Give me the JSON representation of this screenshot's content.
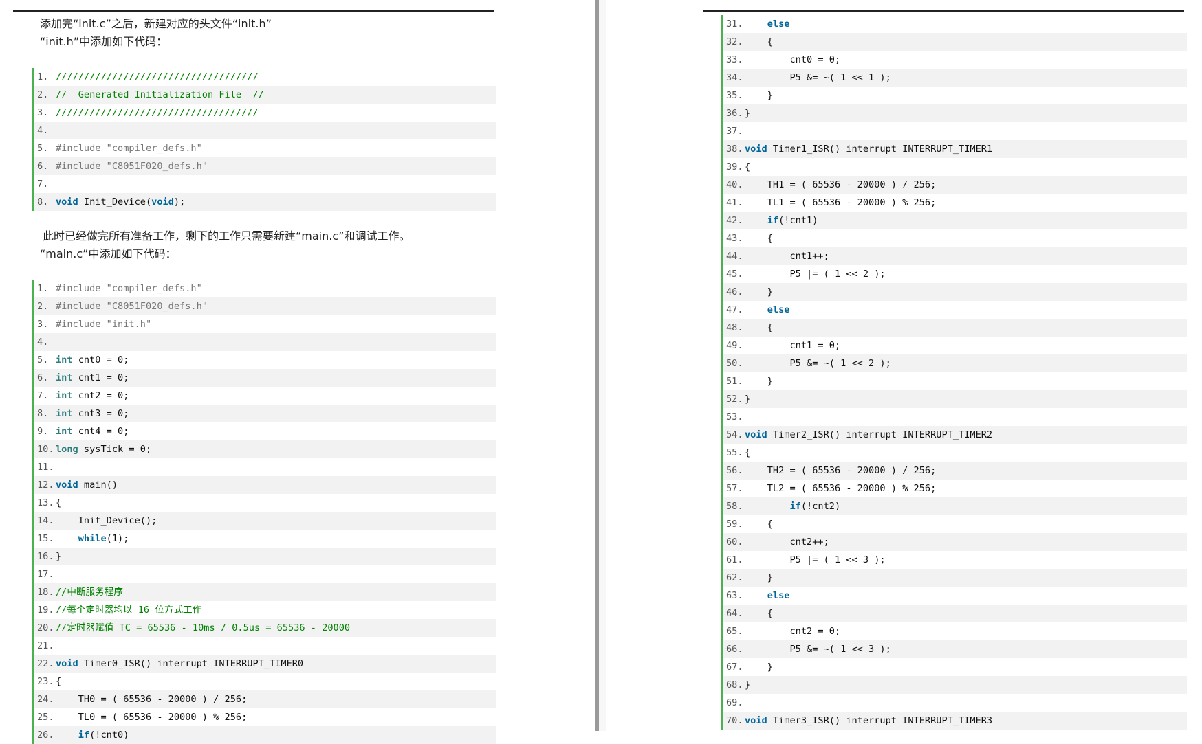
{
  "left_page": {
    "intro_line1": "添加完“init.c”之后，新建对应的头文件“init.h”",
    "intro_line2": "“init.h”中添加如下代码：",
    "init_h_code": [
      {
        "n": "1.",
        "t": "////////////////////////////////////",
        "c": "comment"
      },
      {
        "n": "2.",
        "t": "//  Generated Initialization File  //",
        "c": "comment"
      },
      {
        "n": "3.",
        "t": "////////////////////////////////////",
        "c": "comment"
      },
      {
        "n": "4.",
        "t": "",
        "c": "plain"
      },
      {
        "n": "5.",
        "t": "#include \"compiler_defs.h\"",
        "c": "pp"
      },
      {
        "n": "6.",
        "t": "#include \"C8051F020_defs.h\"",
        "c": "pp"
      },
      {
        "n": "7.",
        "t": "",
        "c": "plain"
      },
      {
        "n": "8.",
        "t": "void Init_Device(void);",
        "c": "plain"
      }
    ],
    "middle_line1": "此时已经做完所有准备工作，剩下的工作只需要新建“main.c”和调试工作。",
    "middle_line2": "“main.c”中添加如下代码：",
    "main_c_code": [
      {
        "n": "1.",
        "t": "#include \"compiler_defs.h\"",
        "c": "pp"
      },
      {
        "n": "2.",
        "t": "#include \"C8051F020_defs.h\"",
        "c": "pp"
      },
      {
        "n": "3.",
        "t": "#include \"init.h\"",
        "c": "pp"
      },
      {
        "n": "4.",
        "t": "",
        "c": "plain"
      },
      {
        "n": "5.",
        "t": "int cnt0 = 0;",
        "c": "plain"
      },
      {
        "n": "6.",
        "t": "int cnt1 = 0;",
        "c": "plain"
      },
      {
        "n": "7.",
        "t": "int cnt2 = 0;",
        "c": "plain"
      },
      {
        "n": "8.",
        "t": "int cnt3 = 0;",
        "c": "plain"
      },
      {
        "n": "9.",
        "t": "int cnt4 = 0;",
        "c": "plain"
      },
      {
        "n": "10.",
        "t": "long sysTick = 0;",
        "c": "plain"
      },
      {
        "n": "11.",
        "t": "",
        "c": "plain"
      },
      {
        "n": "12.",
        "t": "void main()",
        "c": "plain"
      },
      {
        "n": "13.",
        "t": "{",
        "c": "plain"
      },
      {
        "n": "14.",
        "t": "    Init_Device();",
        "c": "plain"
      },
      {
        "n": "15.",
        "t": "    while(1);",
        "c": "plain"
      },
      {
        "n": "16.",
        "t": "}",
        "c": "plain"
      },
      {
        "n": "17.",
        "t": "",
        "c": "plain"
      },
      {
        "n": "18.",
        "t": "//中断服务程序",
        "c": "comment"
      },
      {
        "n": "19.",
        "t": "//每个定时器均以 16 位方式工作",
        "c": "comment"
      },
      {
        "n": "20.",
        "t": "//定时器赋值 TC = 65536 - 10ms / 0.5us = 65536 - 20000",
        "c": "comment"
      },
      {
        "n": "21.",
        "t": "",
        "c": "plain"
      },
      {
        "n": "22.",
        "t": "void Timer0_ISR() interrupt INTERRUPT_TIMER0",
        "c": "plain"
      },
      {
        "n": "23.",
        "t": "{",
        "c": "plain"
      },
      {
        "n": "24.",
        "t": "    TH0 = ( 65536 - 20000 ) / 256;",
        "c": "plain"
      },
      {
        "n": "25.",
        "t": "    TL0 = ( 65536 - 20000 ) % 256;",
        "c": "plain"
      },
      {
        "n": "26.",
        "t": "    if(!cnt0)",
        "c": "plain"
      }
    ]
  },
  "right_page": {
    "code": [
      {
        "n": "31.",
        "t": "    else",
        "c": "plain"
      },
      {
        "n": "32.",
        "t": "    {",
        "c": "plain"
      },
      {
        "n": "33.",
        "t": "        cnt0 = 0;",
        "c": "plain"
      },
      {
        "n": "34.",
        "t": "        P5 &= ~( 1 << 1 );",
        "c": "plain"
      },
      {
        "n": "35.",
        "t": "    }",
        "c": "plain"
      },
      {
        "n": "36.",
        "t": "}",
        "c": "plain"
      },
      {
        "n": "37.",
        "t": "",
        "c": "plain"
      },
      {
        "n": "38.",
        "t": "void Timer1_ISR() interrupt INTERRUPT_TIMER1",
        "c": "plain"
      },
      {
        "n": "39.",
        "t": "{",
        "c": "plain"
      },
      {
        "n": "40.",
        "t": "    TH1 = ( 65536 - 20000 ) / 256;",
        "c": "plain"
      },
      {
        "n": "41.",
        "t": "    TL1 = ( 65536 - 20000 ) % 256;",
        "c": "plain"
      },
      {
        "n": "42.",
        "t": "    if(!cnt1)",
        "c": "plain"
      },
      {
        "n": "43.",
        "t": "    {",
        "c": "plain"
      },
      {
        "n": "44.",
        "t": "        cnt1++;",
        "c": "plain"
      },
      {
        "n": "45.",
        "t": "        P5 |= ( 1 << 2 );",
        "c": "plain"
      },
      {
        "n": "46.",
        "t": "    }",
        "c": "plain"
      },
      {
        "n": "47.",
        "t": "    else",
        "c": "plain"
      },
      {
        "n": "48.",
        "t": "    {",
        "c": "plain"
      },
      {
        "n": "49.",
        "t": "        cnt1 = 0;",
        "c": "plain"
      },
      {
        "n": "50.",
        "t": "        P5 &= ~( 1 << 2 );",
        "c": "plain"
      },
      {
        "n": "51.",
        "t": "    }",
        "c": "plain"
      },
      {
        "n": "52.",
        "t": "}",
        "c": "plain"
      },
      {
        "n": "53.",
        "t": "",
        "c": "plain"
      },
      {
        "n": "54.",
        "t": "void Timer2_ISR() interrupt INTERRUPT_TIMER2",
        "c": "plain"
      },
      {
        "n": "55.",
        "t": "{",
        "c": "plain"
      },
      {
        "n": "56.",
        "t": "    TH2 = ( 65536 - 20000 ) / 256;",
        "c": "plain"
      },
      {
        "n": "57.",
        "t": "    TL2 = ( 65536 - 20000 ) % 256;",
        "c": "plain"
      },
      {
        "n": "58.",
        "t": "        if(!cnt2)",
        "c": "plain"
      },
      {
        "n": "59.",
        "t": "    {",
        "c": "plain"
      },
      {
        "n": "60.",
        "t": "        cnt2++;",
        "c": "plain"
      },
      {
        "n": "61.",
        "t": "        P5 |= ( 1 << 3 );",
        "c": "plain"
      },
      {
        "n": "62.",
        "t": "    }",
        "c": "plain"
      },
      {
        "n": "63.",
        "t": "    else",
        "c": "plain"
      },
      {
        "n": "64.",
        "t": "    {",
        "c": "plain"
      },
      {
        "n": "65.",
        "t": "        cnt2 = 0;",
        "c": "plain"
      },
      {
        "n": "66.",
        "t": "        P5 &= ~( 1 << 3 );",
        "c": "plain"
      },
      {
        "n": "67.",
        "t": "    }",
        "c": "plain"
      },
      {
        "n": "68.",
        "t": "}",
        "c": "plain"
      },
      {
        "n": "69.",
        "t": "",
        "c": "plain"
      },
      {
        "n": "70.",
        "t": "void Timer3_ISR() interrupt INTERRUPT_TIMER3",
        "c": "plain"
      }
    ]
  },
  "colors": {
    "code_border": "#4caf50",
    "comment": "#008200",
    "keyword": "#006699",
    "preprocessor": "#777777"
  }
}
